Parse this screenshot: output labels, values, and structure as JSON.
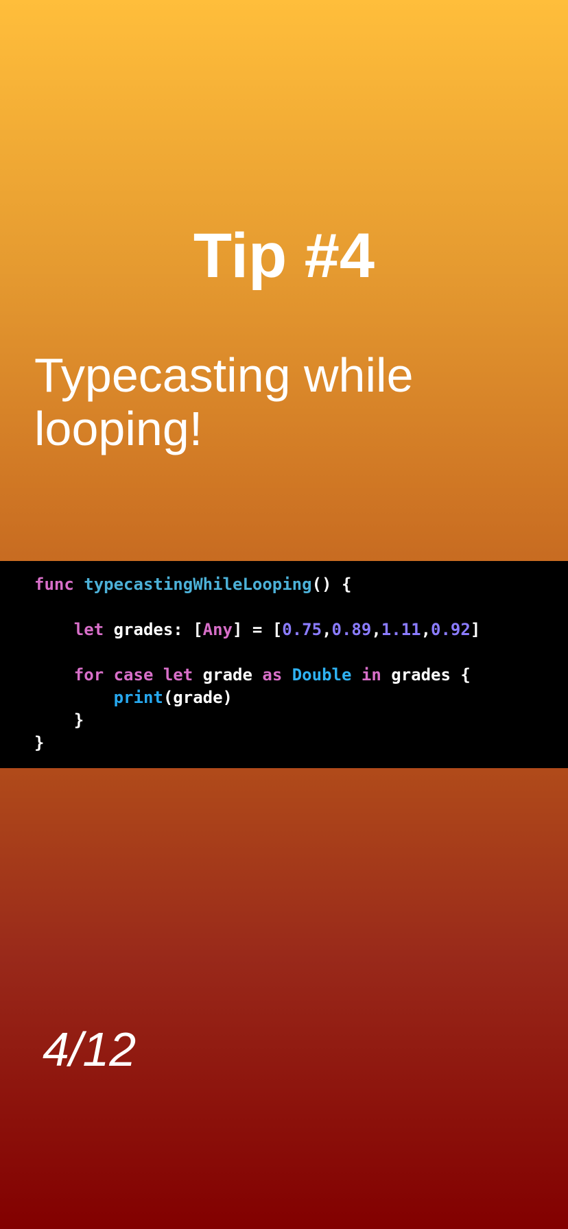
{
  "slide": {
    "title": "Tip #4",
    "subtitle": "Typecasting while looping!",
    "page_indicator": "4/12"
  },
  "code": {
    "language": "swift",
    "lines": [
      [
        {
          "t": "func",
          "c": "keyword"
        },
        {
          "t": " ",
          "c": "plain"
        },
        {
          "t": "typecastingWhileLooping",
          "c": "function-name"
        },
        {
          "t": "() {",
          "c": "plain"
        }
      ],
      [],
      [
        {
          "t": "    ",
          "c": "plain"
        },
        {
          "t": "let",
          "c": "keyword"
        },
        {
          "t": " grades: [",
          "c": "plain"
        },
        {
          "t": "Any",
          "c": "keyword"
        },
        {
          "t": "] = [",
          "c": "plain"
        },
        {
          "t": "0.75",
          "c": "number"
        },
        {
          "t": ",",
          "c": "plain"
        },
        {
          "t": "0.89",
          "c": "number"
        },
        {
          "t": ",",
          "c": "plain"
        },
        {
          "t": "1.11",
          "c": "number"
        },
        {
          "t": ",",
          "c": "plain"
        },
        {
          "t": "0.92",
          "c": "number"
        },
        {
          "t": "]",
          "c": "plain"
        }
      ],
      [],
      [
        {
          "t": "    ",
          "c": "plain"
        },
        {
          "t": "for",
          "c": "keyword"
        },
        {
          "t": " ",
          "c": "plain"
        },
        {
          "t": "case",
          "c": "keyword"
        },
        {
          "t": " ",
          "c": "plain"
        },
        {
          "t": "let",
          "c": "keyword"
        },
        {
          "t": " grade ",
          "c": "plain"
        },
        {
          "t": "as",
          "c": "keyword"
        },
        {
          "t": " ",
          "c": "plain"
        },
        {
          "t": "Double",
          "c": "type"
        },
        {
          "t": " ",
          "c": "plain"
        },
        {
          "t": "in",
          "c": "keyword"
        },
        {
          "t": " grades {",
          "c": "plain"
        }
      ],
      [
        {
          "t": "        ",
          "c": "plain"
        },
        {
          "t": "print",
          "c": "call"
        },
        {
          "t": "(grade)",
          "c": "plain"
        }
      ],
      [
        {
          "t": "    }",
          "c": "plain"
        }
      ],
      [
        {
          "t": "}",
          "c": "plain"
        }
      ]
    ]
  },
  "colors": {
    "gradient_top": "#ffbe3b",
    "gradient_bottom": "#820000",
    "code_background": "#000000",
    "code_plain": "#ffffff",
    "keyword": "#d86fc9",
    "function_name": "#4cb1d8",
    "number": "#8b7cff",
    "type": "#2fb2f2",
    "call": "#27a9f0"
  }
}
